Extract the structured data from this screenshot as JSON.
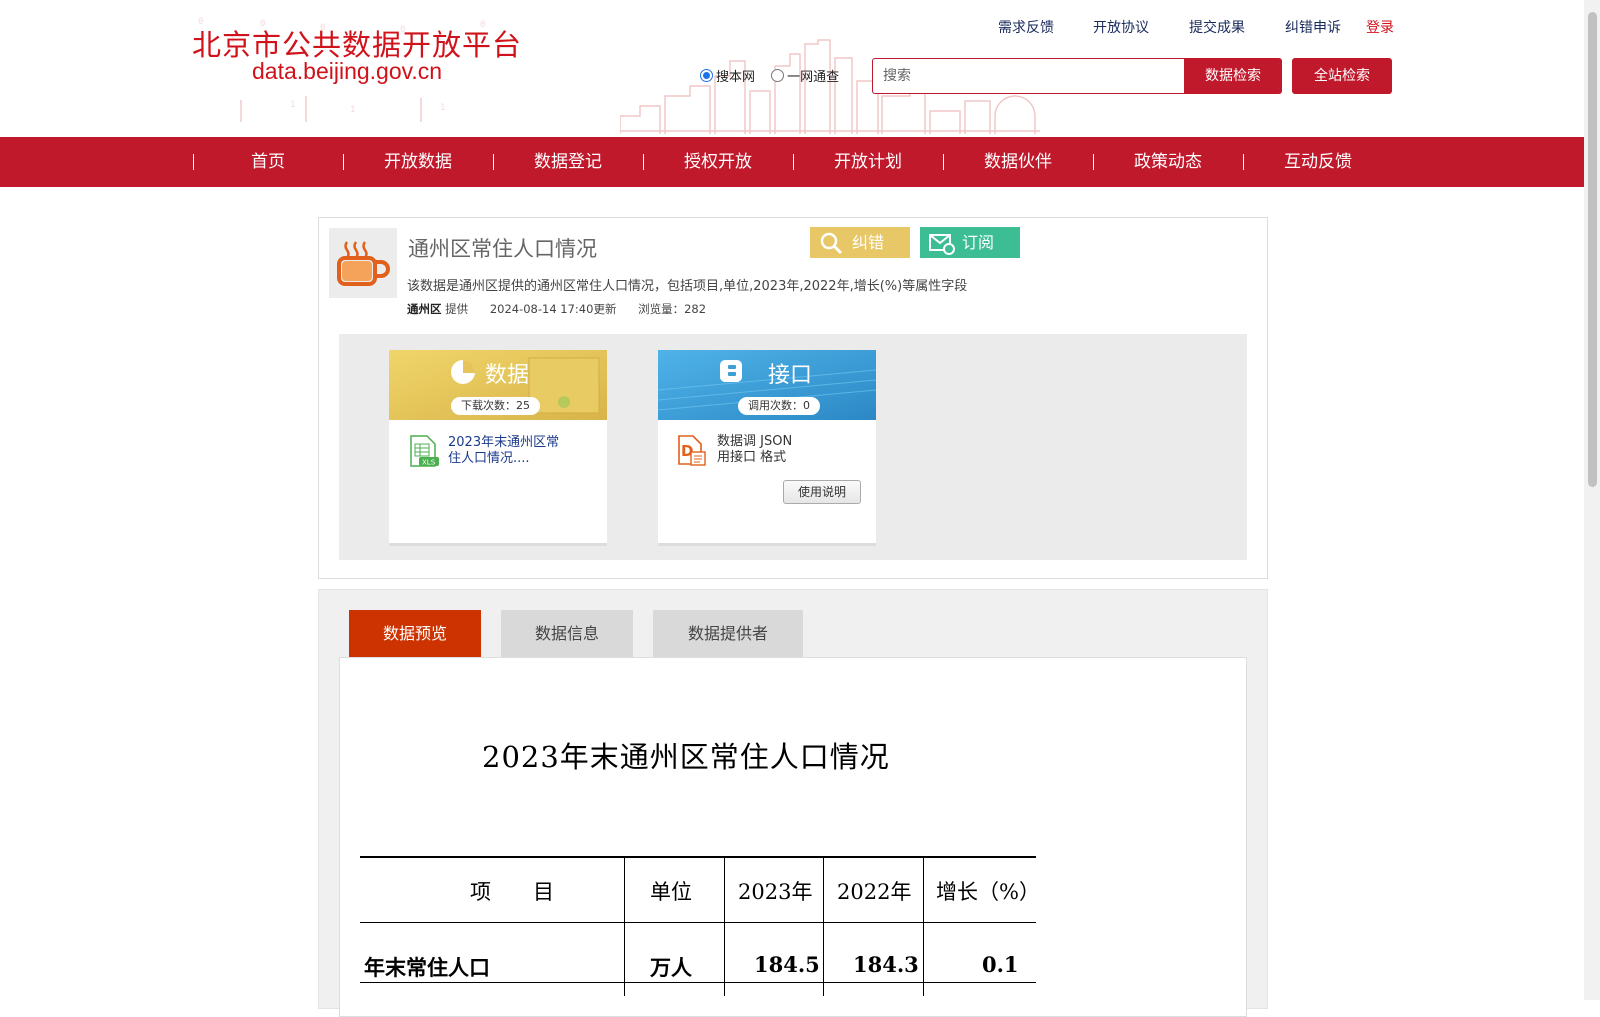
{
  "header": {
    "logo_title": "北京市公共数据开放平台",
    "logo_url": "data.beijing.gov.cn",
    "top_links": [
      "需求反馈",
      "开放协议",
      "提交成果",
      "纠错申诉"
    ],
    "login": "登录",
    "search": {
      "radio_site": "搜本网",
      "radio_unified": "一网通查",
      "selected": "搜本网",
      "placeholder": "搜索",
      "search_button": "数据检索",
      "site_search_button": "全站检索"
    }
  },
  "nav": {
    "items": [
      "首页",
      "开放数据",
      "数据登记",
      "授权开放",
      "开放计划",
      "数据伙伴",
      "政策动态",
      "互动反馈"
    ]
  },
  "dataset": {
    "title": "通州区常住人口情况",
    "fix_label": "纠错",
    "subscribe_label": "订阅",
    "description": "该数据是通州区提供的通州区常住人口情况，包括项目,单位,2023年,2022年,增长(%)等属性字段",
    "provider": "通州区",
    "provider_suffix": "提供",
    "updated": "2024-08-14 17:40更新",
    "views_label": "浏览量：",
    "views": "282",
    "data_tile": {
      "title": "数据",
      "downloads": "下载次数：25",
      "file_name": "2023年末通州区常住人口情况....",
      "file_badge": "XLS"
    },
    "api_tile": {
      "title": "接口",
      "calls": "调用次数：0",
      "line1": "数据调  JSON",
      "line2": "用接口  格式",
      "doc_button": "使用说明"
    },
    "colors": {
      "data_tile": "#e6c45a",
      "api_tile": "#3d9fd6",
      "fix": "#e8c766",
      "subscribe": "#3cbd94",
      "brand": "#c0192c"
    }
  },
  "tabs": [
    {
      "label": "数据预览",
      "active": true
    },
    {
      "label": "数据信息",
      "active": false
    },
    {
      "label": "数据提供者",
      "active": false
    }
  ],
  "preview": {
    "title": "2023年末通州区常住人口情况",
    "headers": [
      "项　　目",
      "单位",
      "2023年",
      "2022年",
      "增长（%）"
    ],
    "rows": [
      [
        "年末常住人口",
        "万人",
        "184.5",
        "184.3",
        "0.1"
      ]
    ]
  }
}
